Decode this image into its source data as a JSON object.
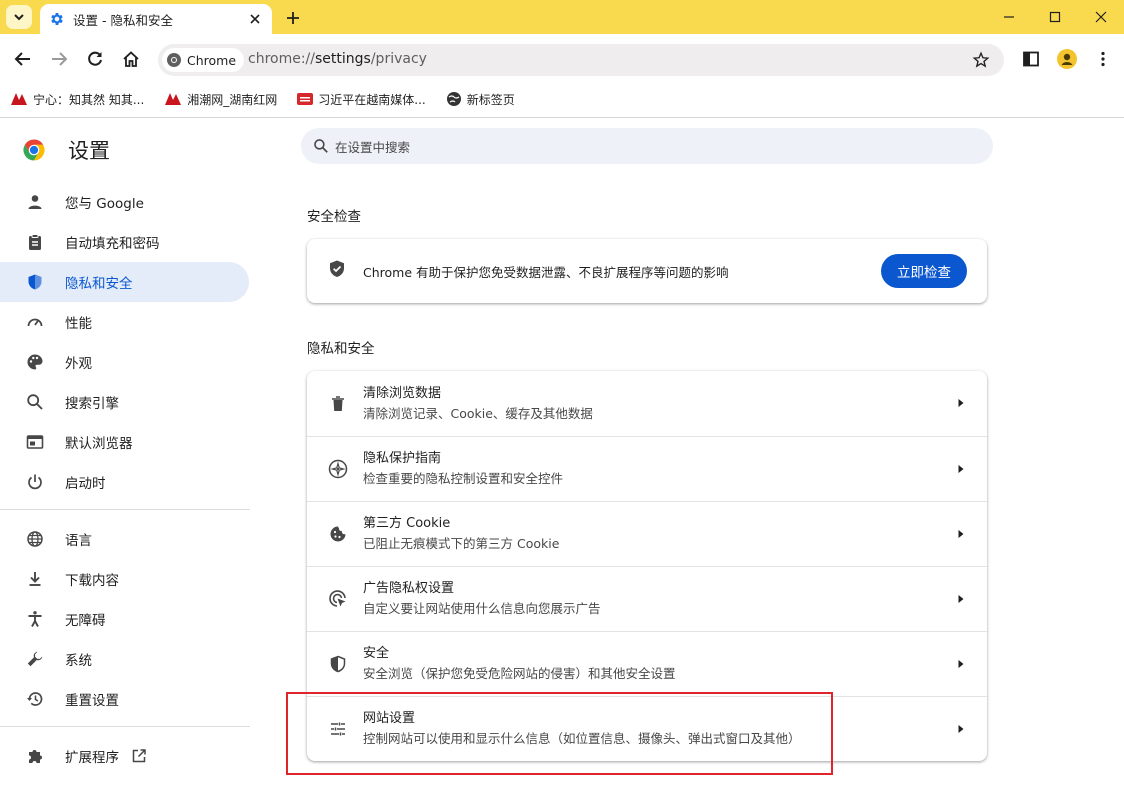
{
  "browser": {
    "tab_title": "设置 - 隐私和安全",
    "chip_label": "Chrome",
    "url_scheme": "chrome://",
    "url_host": "settings",
    "url_path": "/privacy"
  },
  "bookmarks": [
    {
      "label": "宁心：知其然 知其..."
    },
    {
      "label": "湘潮网_湖南红网"
    },
    {
      "label": "习近平在越南媒体..."
    },
    {
      "label": "新标签页"
    }
  ],
  "sidebar": {
    "title": "设置",
    "items": [
      {
        "label": "您与 Google",
        "icon": "person-icon"
      },
      {
        "label": "自动填充和密码",
        "icon": "clipboard-icon"
      },
      {
        "label": "隐私和安全",
        "icon": "shield-icon",
        "active": true
      },
      {
        "label": "性能",
        "icon": "speedometer-icon"
      },
      {
        "label": "外观",
        "icon": "palette-icon"
      },
      {
        "label": "搜索引擎",
        "icon": "search-icon"
      },
      {
        "label": "默认浏览器",
        "icon": "browser-icon"
      },
      {
        "label": "启动时",
        "icon": "power-icon"
      },
      {
        "label": "语言",
        "icon": "globe-icon"
      },
      {
        "label": "下载内容",
        "icon": "download-icon"
      },
      {
        "label": "无障碍",
        "icon": "accessibility-icon"
      },
      {
        "label": "系统",
        "icon": "wrench-icon"
      },
      {
        "label": "重置设置",
        "icon": "history-icon"
      },
      {
        "label": "扩展程序",
        "icon": "puzzle-icon"
      }
    ]
  },
  "search": {
    "placeholder": "在设置中搜索"
  },
  "safety_check": {
    "section_title": "安全检查",
    "text": "Chrome 有助于保护您免受数据泄露、不良扩展程序等问题的影响",
    "button": "立即检查"
  },
  "privacy": {
    "section_title": "隐私和安全",
    "rows": [
      {
        "title": "清除浏览数据",
        "subtitle": "清除浏览记录、Cookie、缓存及其他数据",
        "icon": "trash-icon"
      },
      {
        "title": "隐私保护指南",
        "subtitle": "检查重要的隐私控制设置和安全控件",
        "icon": "compass-icon"
      },
      {
        "title": "第三方 Cookie",
        "subtitle": "已阻止无痕模式下的第三方 Cookie",
        "icon": "cookie-icon"
      },
      {
        "title": "广告隐私权设置",
        "subtitle": "自定义要让网站使用什么信息向您展示广告",
        "icon": "ad-target-icon"
      },
      {
        "title": "安全",
        "subtitle": "安全浏览（保护您免受危险网站的侵害）和其他安全设置",
        "icon": "security-shield-icon"
      },
      {
        "title": "网站设置",
        "subtitle": "控制网站可以使用和显示什么信息（如位置信息、摄像头、弹出式窗口及其他）",
        "icon": "sliders-icon"
      }
    ]
  },
  "colors": {
    "accent": "#0b57d0",
    "titlebar": "#f9d94e",
    "highlight": "#e0242b"
  }
}
